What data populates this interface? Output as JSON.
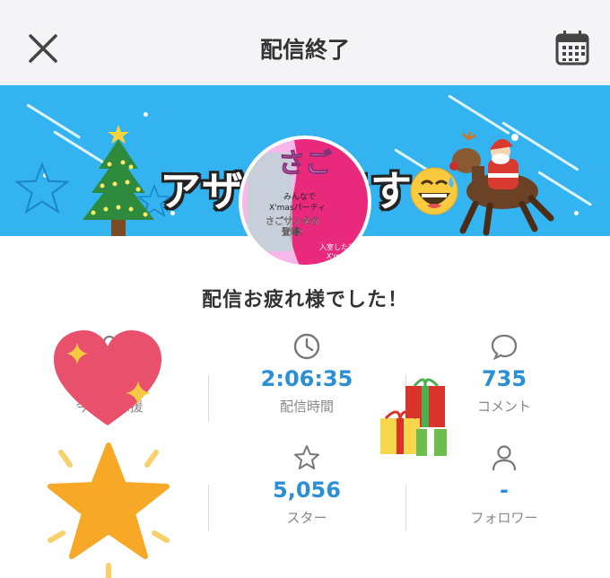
{
  "header": {
    "title": "配信終了",
    "close_icon": "close-icon",
    "calendar_icon": "calendar-icon",
    "background": "#f4f4f6"
  },
  "banner": {
    "background": "#33b3f0",
    "overlay_text": "アザッスです",
    "emoji": "grinning-sweat-emoji",
    "avatar_texts": [
      "さご",
      "みんなで",
      "X'masパーティ",
      "さごサンタ",
      "の登場!",
      "入室した方限",
      "X'mas"
    ]
  },
  "main": {
    "thanks_message": "配信お疲れ様でした！"
  },
  "stats": [
    {
      "icon": "person-icon",
      "value": "",
      "label": "今日の応援"
    },
    {
      "icon": "clock-icon",
      "value": "2:06:35",
      "label": "配信時間"
    },
    {
      "icon": "comment-icon",
      "value": "735",
      "label": "コメント"
    },
    {
      "icon": "heart-sticker-icon",
      "value": "",
      "label": ""
    },
    {
      "icon": "star-outline-icon",
      "value": "5,056",
      "label": "スター"
    },
    {
      "icon": "person-outline-icon",
      "value": "-",
      "label": "フォロワー"
    }
  ],
  "colors": {
    "accent": "#2b8fd6",
    "label": "#888888",
    "heart": "#e94f6a",
    "star": "#f5a623"
  }
}
